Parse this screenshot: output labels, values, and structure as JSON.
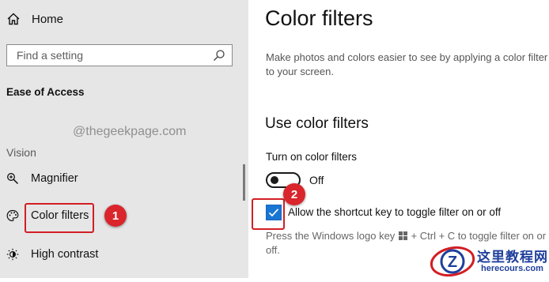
{
  "sidebar": {
    "home_label": "Home",
    "search_placeholder": "Find a setting",
    "section_title": "Ease of Access",
    "watermark": "@thegeekpage.com",
    "group_label": "Vision",
    "items": [
      {
        "label": "Magnifier",
        "icon": "magnifier-icon"
      },
      {
        "label": "Color filters",
        "icon": "palette-icon",
        "selected": true
      },
      {
        "label": "High contrast",
        "icon": "high-contrast-icon"
      }
    ]
  },
  "main": {
    "title": "Color filters",
    "description": "Make photos and colors easier to see by applying a color filter to your screen.",
    "subheading": "Use color filters",
    "toggle_caption": "Turn on color filters",
    "toggle_state": "Off",
    "toggle_on": false,
    "checkbox_label": "Allow the shortcut key to toggle filter on or off",
    "checkbox_checked": true,
    "helper_prefix": "Press the Windows logo key",
    "helper_suffix": "+ Ctrl + C to toggle filter on or off."
  },
  "annotations": {
    "badge_1": "1",
    "badge_2": "2",
    "highlight_color": "#d21e24"
  },
  "logo": {
    "text_cn": "这里教程网",
    "text_en": "herecours.com",
    "letter": "Z"
  },
  "colors": {
    "sidebar_bg": "#e6e6e6",
    "accent": "#1976d2",
    "badge": "#d9252b",
    "logo_blue": "#1f3f9c"
  }
}
